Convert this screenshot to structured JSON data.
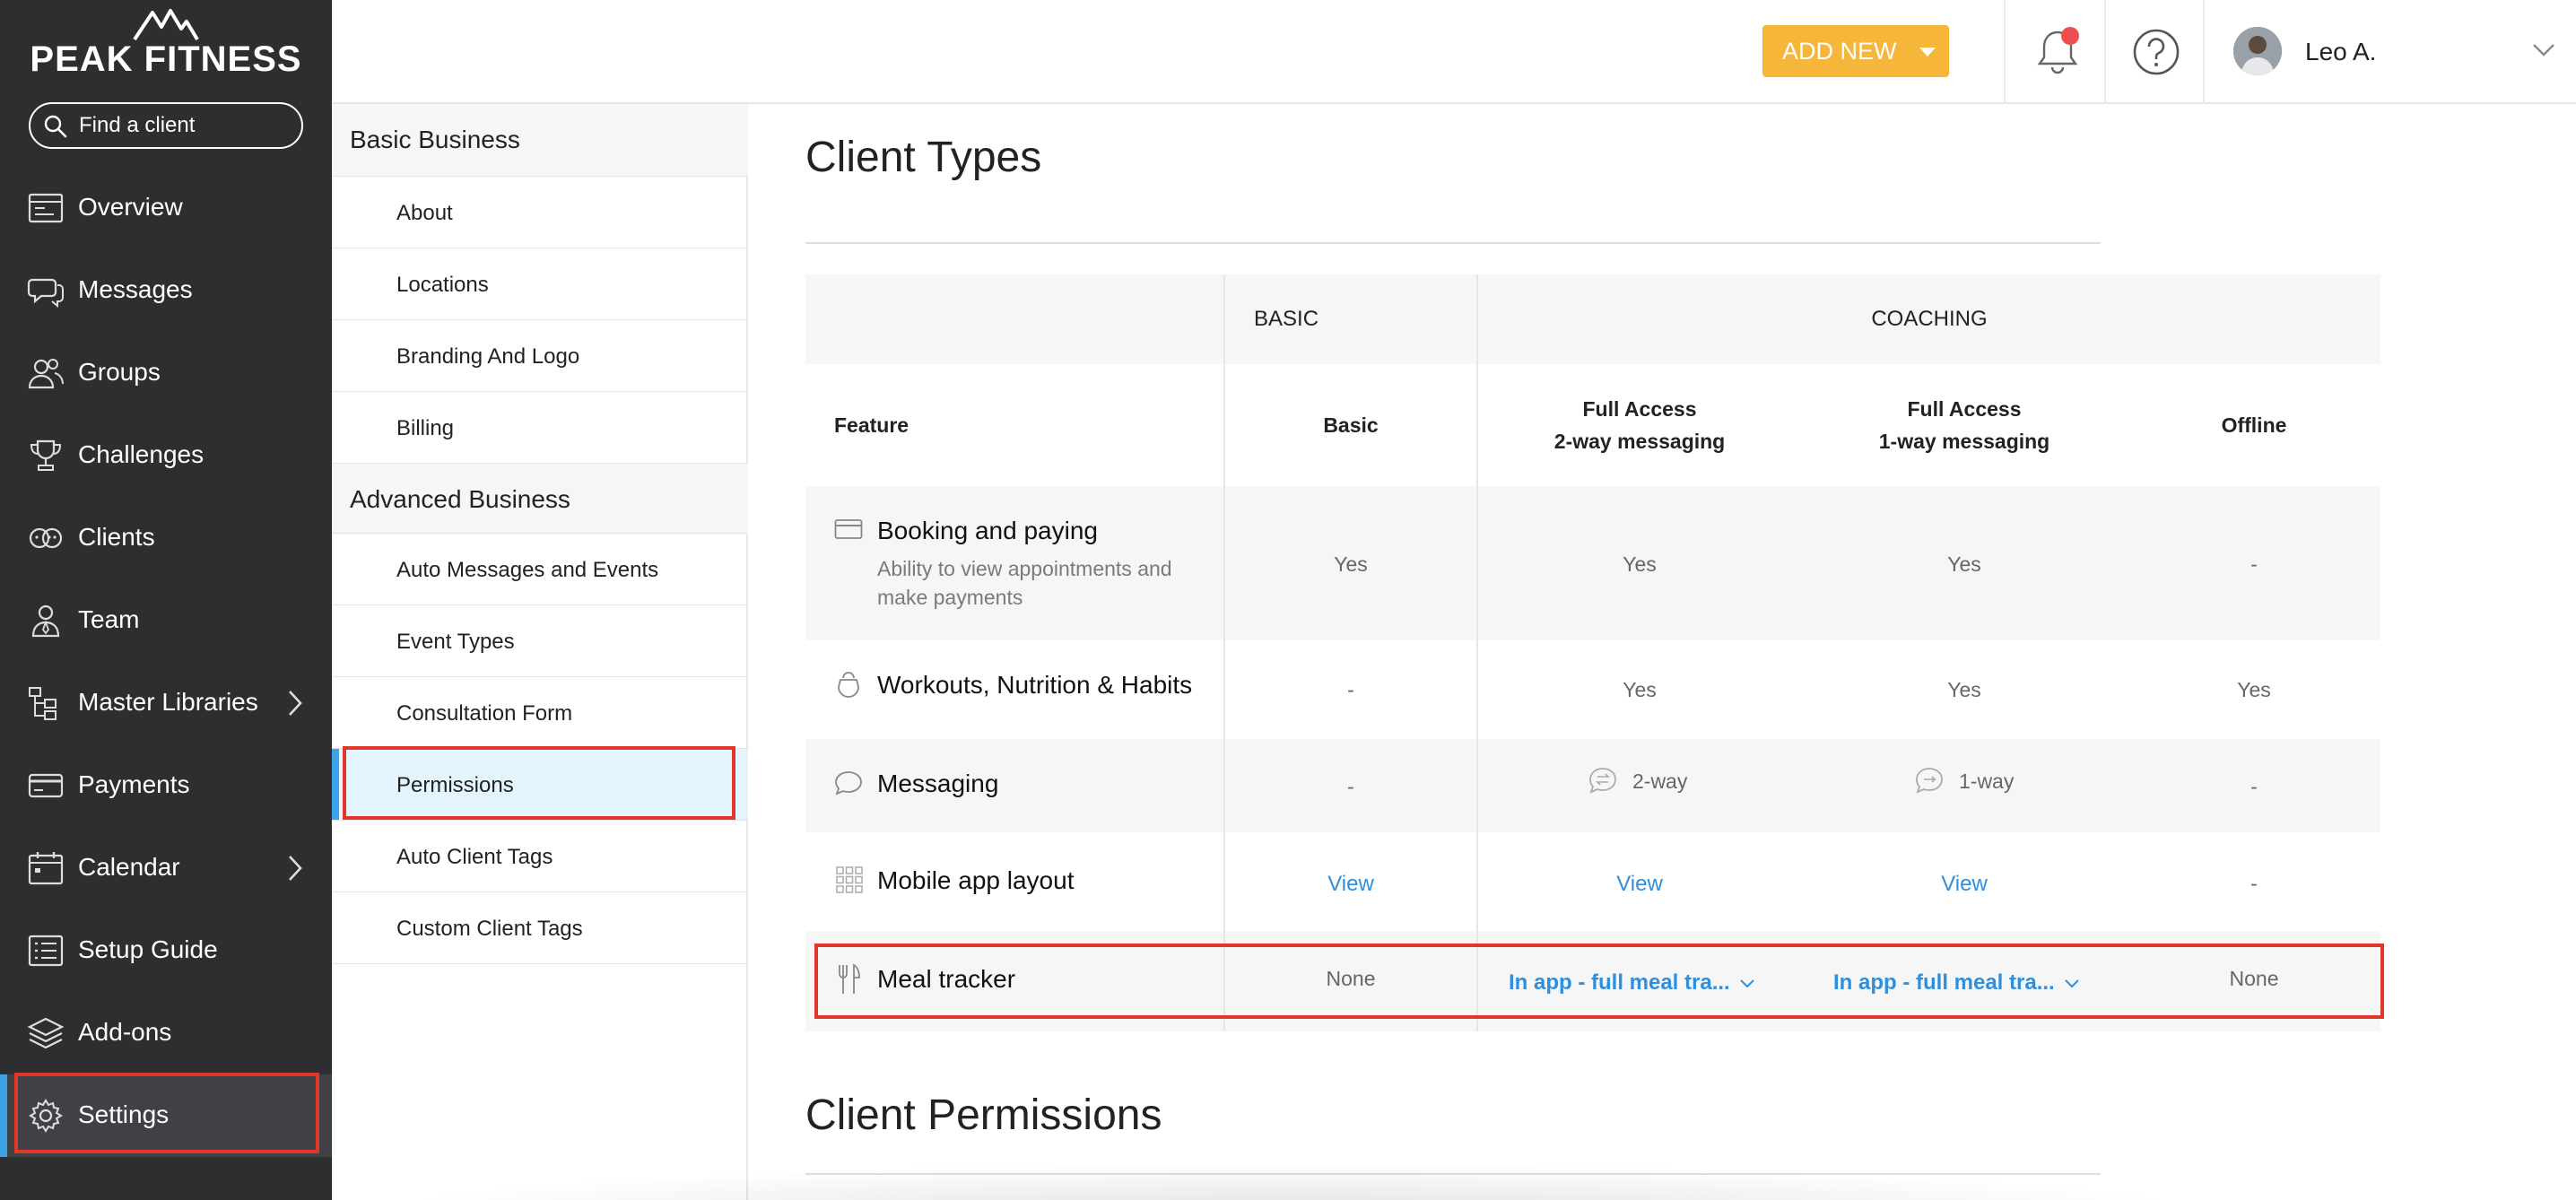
{
  "brand": {
    "name": "PEAK FITNESS"
  },
  "search": {
    "placeholder": "Find a client"
  },
  "nav": {
    "items": [
      {
        "label": "Overview",
        "icon": "dashboard-icon"
      },
      {
        "label": "Messages",
        "icon": "chat-bubbles-icon"
      },
      {
        "label": "Groups",
        "icon": "users-icon"
      },
      {
        "label": "Challenges",
        "icon": "trophy-icon"
      },
      {
        "label": "Clients",
        "icon": "client-faces-icon"
      },
      {
        "label": "Team",
        "icon": "team-member-icon"
      },
      {
        "label": "Master Libraries",
        "icon": "hierarchy-icon"
      },
      {
        "label": "Payments",
        "icon": "credit-card-icon"
      },
      {
        "label": "Calendar",
        "icon": "calendar-icon"
      },
      {
        "label": "Setup Guide",
        "icon": "checklist-icon"
      },
      {
        "label": "Add-ons",
        "icon": "layers-icon"
      },
      {
        "label": "Settings",
        "icon": "gear-icon"
      }
    ],
    "active": "Settings"
  },
  "topbar": {
    "add_new": "ADD NEW",
    "user_name": "Leo A."
  },
  "settings_menu": {
    "basic_heading": "Basic Business",
    "basic_items": [
      "About",
      "Locations",
      "Branding And Logo",
      "Billing"
    ],
    "advanced_heading": "Advanced Business",
    "advanced_items": [
      "Auto Messages and Events",
      "Event Types",
      "Consultation Form",
      "Permissions",
      "Auto Client Tags",
      "Custom Client Tags"
    ],
    "active": "Permissions"
  },
  "client_types": {
    "title": "Client Types",
    "groups": [
      "BASIC",
      "COACHING"
    ],
    "feature_header": "Feature",
    "columns": [
      [
        "Basic"
      ],
      [
        "Full Access",
        "2-way messaging"
      ],
      [
        "Full Access",
        "1-way messaging"
      ],
      [
        "Offline"
      ]
    ],
    "rows": [
      {
        "name": "Booking and paying",
        "desc": [
          "Ability to view appointments and",
          "make payments"
        ],
        "icon": "credit-card-icon",
        "values": [
          "Yes",
          "Yes",
          "Yes",
          "-"
        ]
      },
      {
        "name": "Workouts, Nutrition & Habits",
        "icon": "kettlebell-icon",
        "values": [
          "-",
          "Yes",
          "Yes",
          "Yes"
        ]
      },
      {
        "name": "Messaging",
        "icon": "chat-bubble-icon",
        "values": [
          "-",
          "2-way",
          "1-way",
          "-"
        ]
      },
      {
        "name": "Mobile app layout",
        "icon": "grid-icon",
        "values": [
          "View",
          "View",
          "View",
          "-"
        ]
      },
      {
        "name": "Meal tracker",
        "icon": "fork-knife-icon",
        "values": [
          "None",
          "In app - full meal tra...",
          "In app - full meal tra...",
          "None"
        ]
      }
    ]
  },
  "client_permissions": {
    "title": "Client Permissions"
  }
}
